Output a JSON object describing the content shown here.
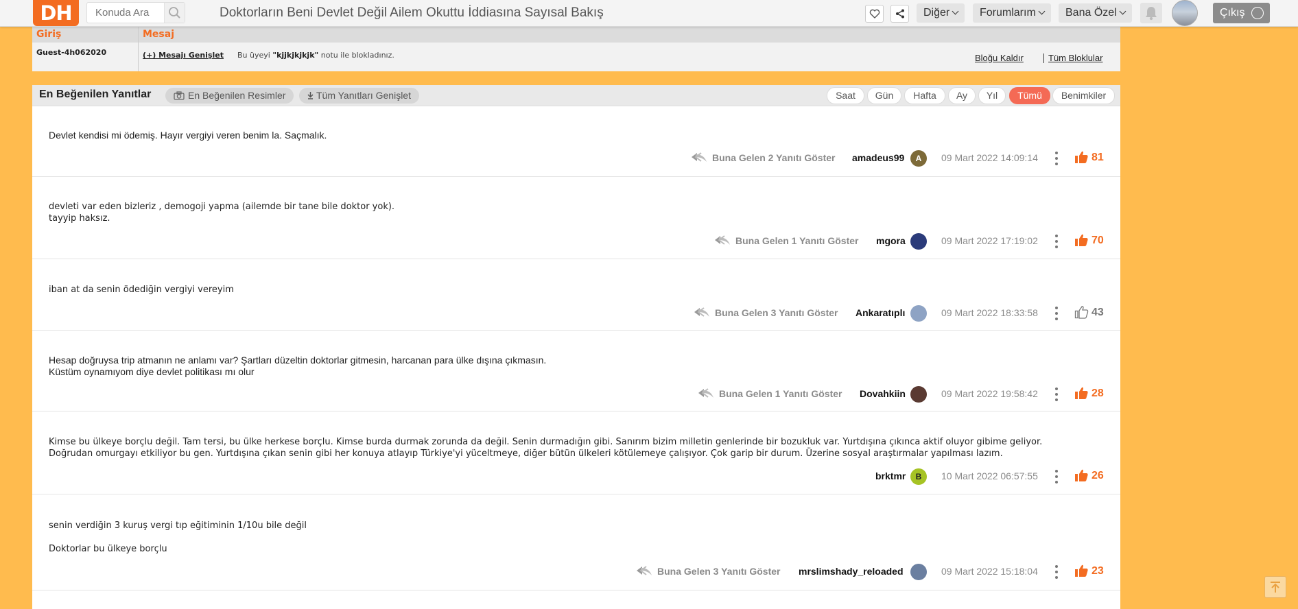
{
  "header": {
    "logo": "DH",
    "search_placeholder": "Konuda Ara",
    "title": "Doktorların Beni Devlet Değil Ailem Okuttu İddiasına Sayısal Bakış",
    "menus": [
      "Diğer",
      "Forumlarım",
      "Bana Özel"
    ],
    "logout": "Çıkış"
  },
  "blocked": {
    "col_entry": "Giriş",
    "col_message": "Mesaj",
    "user": "Guest-4h062020",
    "expand": "(+) Mesajı Genişlet",
    "notice_prefix": "Bu üyeyi",
    "notice_name": "\"kjjkjkjkjk\"",
    "notice_suffix": "notu ile blokladınız.",
    "unblock": "Bloğu Kaldır",
    "all_blocks": "Tüm Bloklular"
  },
  "replies": {
    "title": "En Beğenilen Yanıtlar",
    "images_btn": "En Beğenilen Resimler",
    "expand_all_btn": "Tüm Yanıtları Genişlet",
    "filters": [
      "Saat",
      "Gün",
      "Hafta",
      "Ay",
      "Yıl",
      "Tümü",
      "Benimkiler"
    ],
    "active_filter": "Tümü",
    "posts": [
      {
        "text": "Devlet kendisi mi ödemiş. Hayır vergiyi veren benim la. Saçmalık.",
        "replies": "Buna Gelen 2 Yanıtı Göster",
        "user": "amadeus99",
        "avatar_letter": "A",
        "avatar_color": "#7d6a38",
        "date": "09 Mart 2022 14:09:14",
        "likes": "81",
        "liked": true
      },
      {
        "text": "devleti var eden bizleriz , demogoji yapma (ailemde bir tane bile doktor yok).\ntayyip haksız.",
        "replies": "Buna Gelen 1 Yanıtı Göster",
        "user": "mgora",
        "avatar_letter": "",
        "avatar_color": "#2b3b7a",
        "date": "09 Mart 2022 17:19:02",
        "likes": "70",
        "liked": true
      },
      {
        "text": "iban at da senin ödediğin vergiyi vereyim",
        "replies": "Buna Gelen 3 Yanıtı Göster",
        "user": "Ankaratıplı",
        "avatar_letter": "",
        "avatar_color": "#8ea3c4",
        "date": "09 Mart 2022 18:33:58",
        "likes": "43",
        "liked": false
      },
      {
        "text": "Hesap doğruysa trip atmanın ne anlamı var? Şartları düzeltin doktorlar gitmesin, harcanan para ülke dışına çıkmasın.\nKüstüm oynamıyom diye devlet politikası mı olur",
        "replies": "Buna Gelen 1 Yanıtı Göster",
        "user": "Dovahkiin",
        "avatar_letter": "",
        "avatar_color": "#5a3a32",
        "date": "09 Mart 2022 19:58:42",
        "likes": "28",
        "liked": true
      },
      {
        "text": "Kimse bu ülkeye borçlu değil. Tam tersi, bu ülke herkese borçlu. Kimse burda durmak zorunda da değil. Senin durmadığın gibi. Sanırım bizim milletin genlerinde bir bozukluk var. Yurtdışına çıkınca aktif oluyor gibime geliyor.\nDoğrudan omurgayı etkiliyor bu gen. Yurtdışına çıkan senin gibi her konuya atlayıp Türkiye'yi yüceltmeye, diğer bütün ülkeleri kötülemeye çalışıyor. Çok garip bir durum. Üzerine sosyal araştırmalar yapılması lazım.",
        "replies": "",
        "user": "brktmr",
        "avatar_letter": "B",
        "avatar_color": "#a6c324",
        "date": "10 Mart 2022 06:57:55",
        "likes": "26",
        "liked": true
      },
      {
        "text": "senin verdiğin 3 kuruş vergi tıp eğitiminin 1/10u bile değil\n\nDoktorlar bu ülkeye borçlu",
        "replies": "Buna Gelen 3 Yanıtı Göster",
        "user": "mrslimshady_reloaded",
        "avatar_letter": "",
        "avatar_color": "#6b7fa0",
        "date": "09 Mart 2022 15:18:04",
        "likes": "23",
        "liked": true
      }
    ]
  },
  "colors": {
    "accent": "#f36c21",
    "page_bg": "#ffbb4e",
    "active_filter": "#f46a55"
  },
  "icons": [
    "search-icon",
    "heart-icon",
    "share-icon",
    "bell-icon",
    "reply-icon",
    "thumbs-up-icon",
    "kebab-icon",
    "camera-icon",
    "download-icon",
    "scroll-top-icon",
    "logout-icon"
  ]
}
